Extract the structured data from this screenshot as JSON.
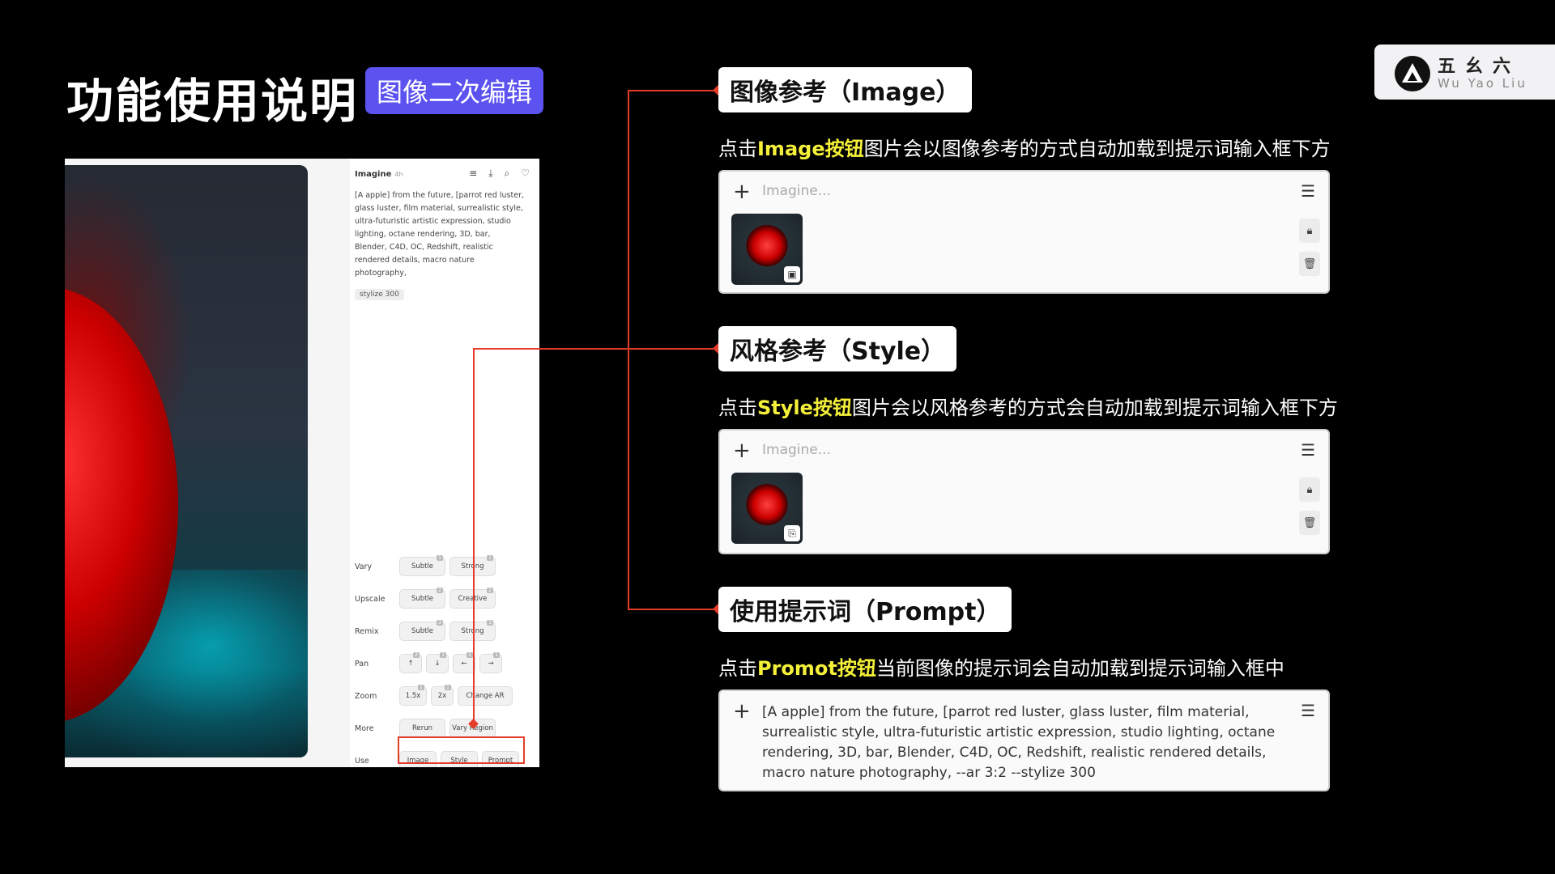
{
  "header": {
    "title": "功能使用说明",
    "badge": "图像二次编辑"
  },
  "logo": {
    "cn": "五幺六",
    "en": "Wu Yao Liu"
  },
  "screenshot": {
    "side_title": "Imagine",
    "side_time": "4h",
    "icons": [
      "menu-icon",
      "download-icon",
      "search-icon",
      "heart-icon"
    ],
    "prompt": "[A apple] from the future, [parrot red luster, glass luster, film material, surrealistic style, ultra-futuristic artistic expression, studio lighting, octane rendering, 3D, bar, Blender, C4D, OC, Redshift, realistic rendered details, macro nature photography,",
    "chip": "stylize 300",
    "rows": [
      {
        "label": "Vary",
        "buttons": [
          {
            "text": "Subtle",
            "n": "1"
          },
          {
            "text": "Strong",
            "n": "1"
          }
        ]
      },
      {
        "label": "Upscale",
        "buttons": [
          {
            "text": "Subtle",
            "n": "2"
          },
          {
            "text": "Creative",
            "n": "2"
          }
        ]
      },
      {
        "label": "Remix",
        "buttons": [
          {
            "text": "Subtle",
            "n": "3"
          },
          {
            "text": "Strong",
            "n": "3"
          }
        ]
      },
      {
        "label": "Pan",
        "buttons": [
          {
            "text": "↑",
            "n": "2"
          },
          {
            "text": "↓",
            "n": "1"
          },
          {
            "text": "←",
            "n": "1"
          },
          {
            "text": "→",
            "n": "1"
          }
        ]
      },
      {
        "label": "Zoom",
        "buttons": [
          {
            "text": "1.5x",
            "n": "1"
          },
          {
            "text": "2x",
            "n": "1"
          },
          {
            "text": "Change AR",
            "n": ""
          }
        ]
      },
      {
        "label": "More",
        "buttons": [
          {
            "text": "Rerun",
            "n": ""
          },
          {
            "text": "Vary Region",
            "n": ""
          }
        ]
      },
      {
        "label": "Use",
        "buttons": [
          {
            "text": "Image",
            "n": ""
          },
          {
            "text": "Style",
            "n": ""
          },
          {
            "text": "Prompt",
            "n": ""
          }
        ]
      }
    ]
  },
  "sections": [
    {
      "label": "图像参考（Image）",
      "desc_prefix": "点击",
      "desc_highlight": "Image按钮",
      "desc_suffix": "图片会以图像参考的方式自动加载到提示词输入框下方",
      "placeholder": "Imagine...",
      "thumb_badge": "image-icon"
    },
    {
      "label": "风格参考（Style）",
      "desc_prefix": "点击",
      "desc_highlight": "Style按钮",
      "desc_suffix": "图片会以风格参考的方式会自动加载到提示词输入框下方",
      "placeholder": "Imagine...",
      "thumb_badge": "paperclip-icon"
    },
    {
      "label": "使用提示词（Prompt）",
      "desc_prefix": "点击",
      "desc_highlight": "Promot按钮",
      "desc_suffix": "当前图像的提示词会自动加载到提示词输入框中",
      "prompt_text": "[A apple] from the future, [parrot red luster, glass luster, film material, surrealistic style, ultra-futuristic artistic expression, studio lighting, octane rendering, 3D, bar, Blender, C4D, OC, Redshift, realistic rendered details, macro nature photography, --ar 3:2 --stylize 300"
    }
  ],
  "colors": {
    "accent_red": "#e53c2a",
    "badge_purple": "#5b52f0",
    "highlight_yellow": "#f4f03a"
  }
}
